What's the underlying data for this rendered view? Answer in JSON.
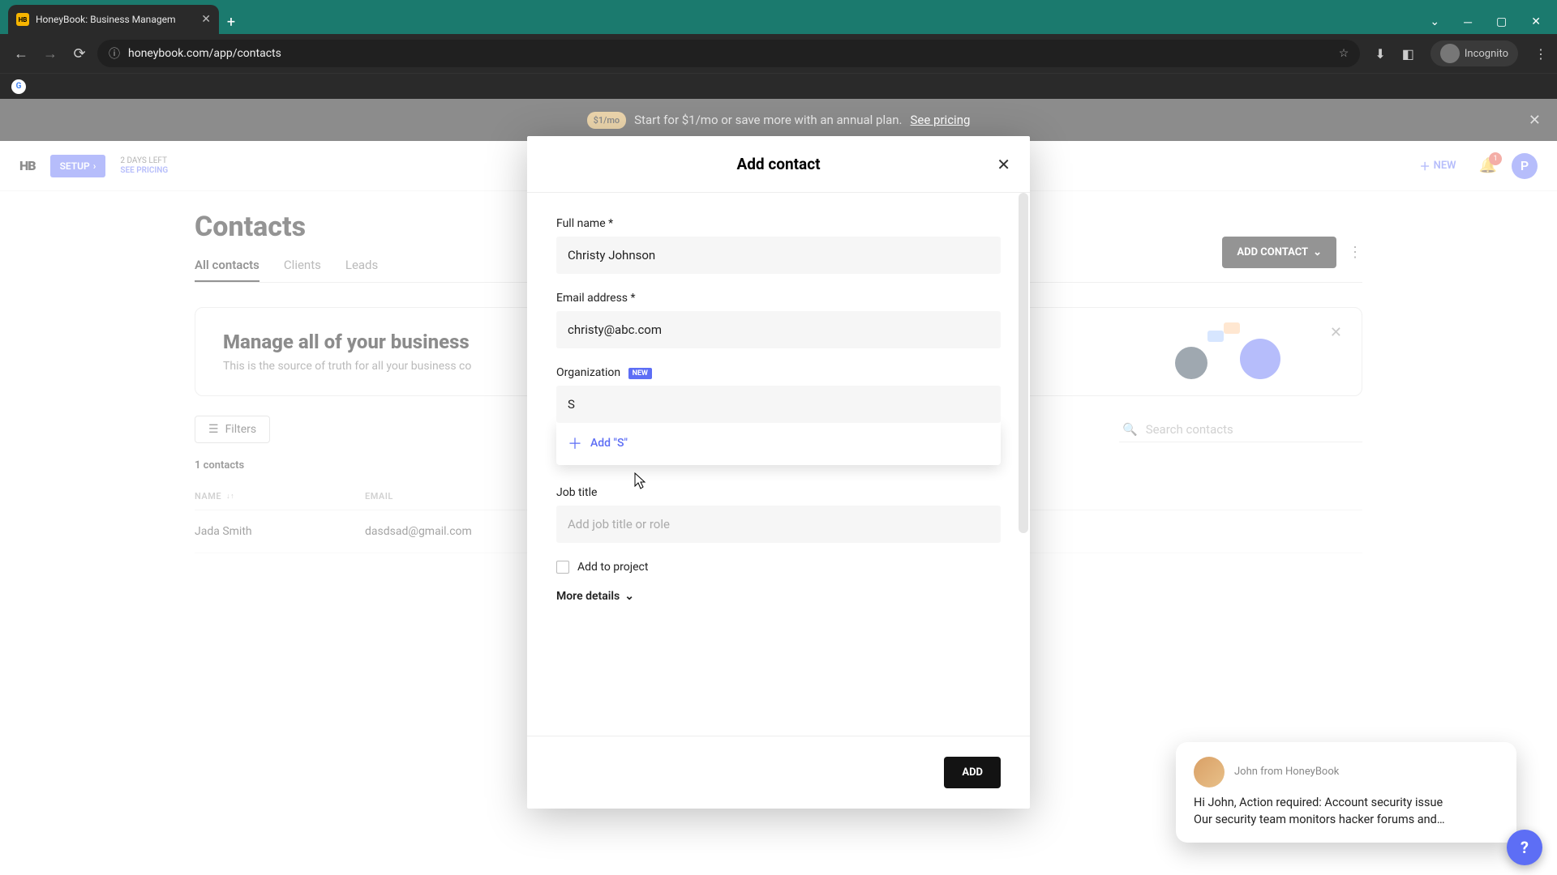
{
  "browser": {
    "tab_title": "HoneyBook: Business Managem",
    "url": "honeybook.com/app/contacts",
    "incognito_label": "Incognito"
  },
  "promo": {
    "pill": "$1/mo",
    "text": "Start for $1/mo or save more with an annual plan.",
    "link": "See pricing"
  },
  "header": {
    "setup": "SETUP",
    "trial_days": "2 DAYS LEFT",
    "trial_link": "SEE PRICING",
    "new": "NEW",
    "bell_count": "1",
    "avatar_letter": "P"
  },
  "page": {
    "title": "Contacts",
    "tabs": [
      "All contacts",
      "Clients",
      "Leads"
    ],
    "add_contact": "ADD CONTACT",
    "info_title": "Manage all of your business",
    "info_sub": "This is the source of truth for all your business co",
    "filters": "Filters",
    "search_placeholder": "Search contacts",
    "count": "1 contacts",
    "col_name": "NAME",
    "col_email": "EMAIL",
    "row_name": "Jada Smith",
    "row_email": "dasdsad@gmail.com"
  },
  "modal": {
    "title": "Add contact",
    "full_name_label": "Full name",
    "full_name_value": "Christy Johnson",
    "email_label": "Email address",
    "email_value": "christy@abc.com",
    "org_label": "Organization",
    "org_badge": "NEW",
    "org_value": "S",
    "org_suggest": "Add \"S\"",
    "job_label": "Job title",
    "job_placeholder": "Add job title or role",
    "add_to_project": "Add to project",
    "more_details": "More details",
    "add_button": "ADD"
  },
  "chat": {
    "sender": "John from HoneyBook",
    "line1": "Hi John, Action required: Account security issue",
    "line2": "Our security team monitors hacker forums and…"
  }
}
